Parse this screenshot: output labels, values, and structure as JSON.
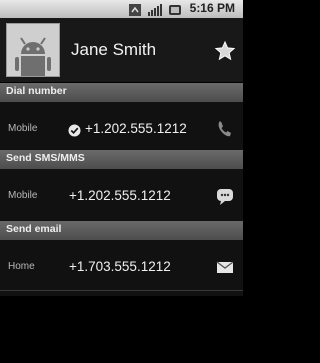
{
  "status_bar": {
    "time": "5:16 PM"
  },
  "contact": {
    "name": "Jane Smith"
  },
  "sections": {
    "dial": {
      "title": "Dial number",
      "type": "Mobile",
      "value": "+1.202.555.1212"
    },
    "sms": {
      "title": "Send SMS/MMS",
      "type": "Mobile",
      "value": "+1.202.555.1212"
    },
    "email": {
      "title": "Send email",
      "type": "Home",
      "value": "+1.703.555.1212"
    }
  },
  "icons": {
    "wifi": "wifi-icon",
    "signal": "signal-icon",
    "battery": "battery-icon",
    "star": "star-icon",
    "check": "check-icon",
    "phone": "phone-icon",
    "message": "message-icon",
    "mail": "mail-icon"
  }
}
